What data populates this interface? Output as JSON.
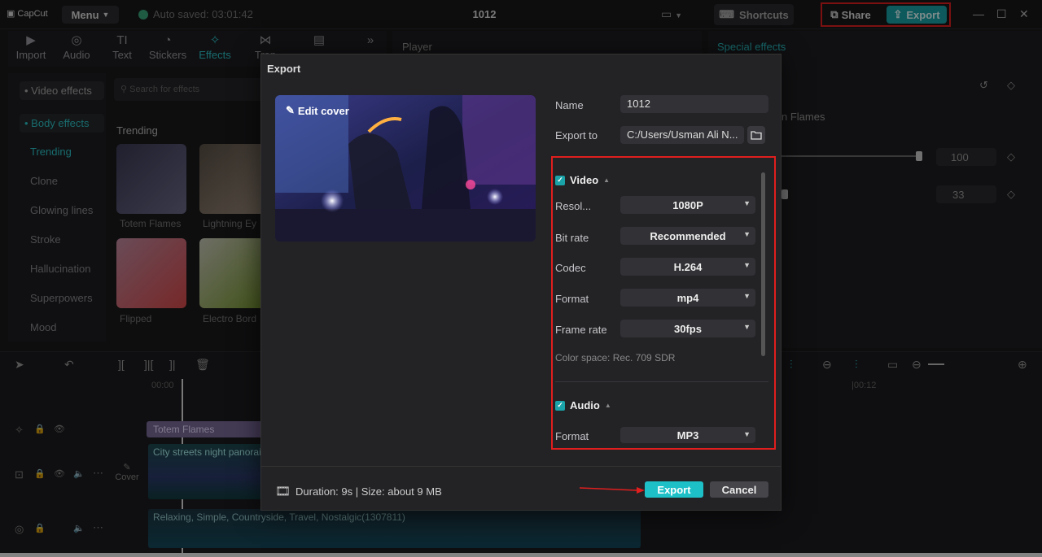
{
  "app": {
    "logo": "CapCut",
    "menu_label": "Menu",
    "autosave": "Auto saved: 03:01:42",
    "project_title": "1012",
    "shortcuts_label": "Shortcuts",
    "share_label": "Share",
    "export_label": "Export"
  },
  "media_tabs": [
    {
      "label": "Import",
      "icon": "import-icon"
    },
    {
      "label": "Audio",
      "icon": "audio-icon"
    },
    {
      "label": "Text",
      "icon": "text-icon"
    },
    {
      "label": "Stickers",
      "icon": "stickers-icon"
    },
    {
      "label": "Effects",
      "icon": "effects-icon"
    },
    {
      "label": "Tran",
      "icon": "transitions-icon"
    },
    {
      "label": "",
      "icon": "captions-icon"
    }
  ],
  "left_nav": {
    "video_effects": "• Video effects",
    "body_effects": "• Body effects",
    "items": [
      "Trending",
      "Clone",
      "Glowing lines",
      "Stroke",
      "Hallucination",
      "Superpowers",
      "Mood"
    ]
  },
  "effects_panel": {
    "search_placeholder": "Search for effects",
    "trending_label": "Trending",
    "thumbs": [
      "Totem Flames",
      "Lightning Ey",
      "Flipped",
      "Electro Bord"
    ]
  },
  "player": {
    "label": "Player"
  },
  "right_panel": {
    "title": "Special effects",
    "effect_name": "n Flames",
    "value1": "100",
    "value2": "33"
  },
  "timeline": {
    "time0": "00:00",
    "time12": "|00:12",
    "effect_clip": "Totem Flames",
    "video_clip": "City streets night panorai",
    "cover_label": "Cover",
    "audio_clip": "Relaxing, Simple, Countryside, Travel, Nostalgic(1307811)"
  },
  "dialog": {
    "title": "Export",
    "edit_cover": "Edit cover",
    "name_label": "Name",
    "name_value": "1012",
    "export_to_label": "Export to",
    "export_to_value": "C:/Users/Usman Ali N...",
    "video_section": "Video",
    "resolution_label": "Resol...",
    "resolution_value": "1080P",
    "bitrate_label": "Bit rate",
    "bitrate_value": "Recommended",
    "codec_label": "Codec",
    "codec_value": "H.264",
    "format_label": "Format",
    "format_value": "mp4",
    "framerate_label": "Frame rate",
    "framerate_value": "30fps",
    "colorspace": "Color space: Rec. 709 SDR",
    "audio_section": "Audio",
    "audio_format_label": "Format",
    "audio_format_value": "MP3",
    "duration": "Duration: 9s | Size: about 9 MB",
    "export_button": "Export",
    "cancel_button": "Cancel"
  },
  "colors": {
    "accent": "#1ec0c8",
    "highlight_box": "#e01e1e",
    "bg": "#1a1a1c"
  }
}
